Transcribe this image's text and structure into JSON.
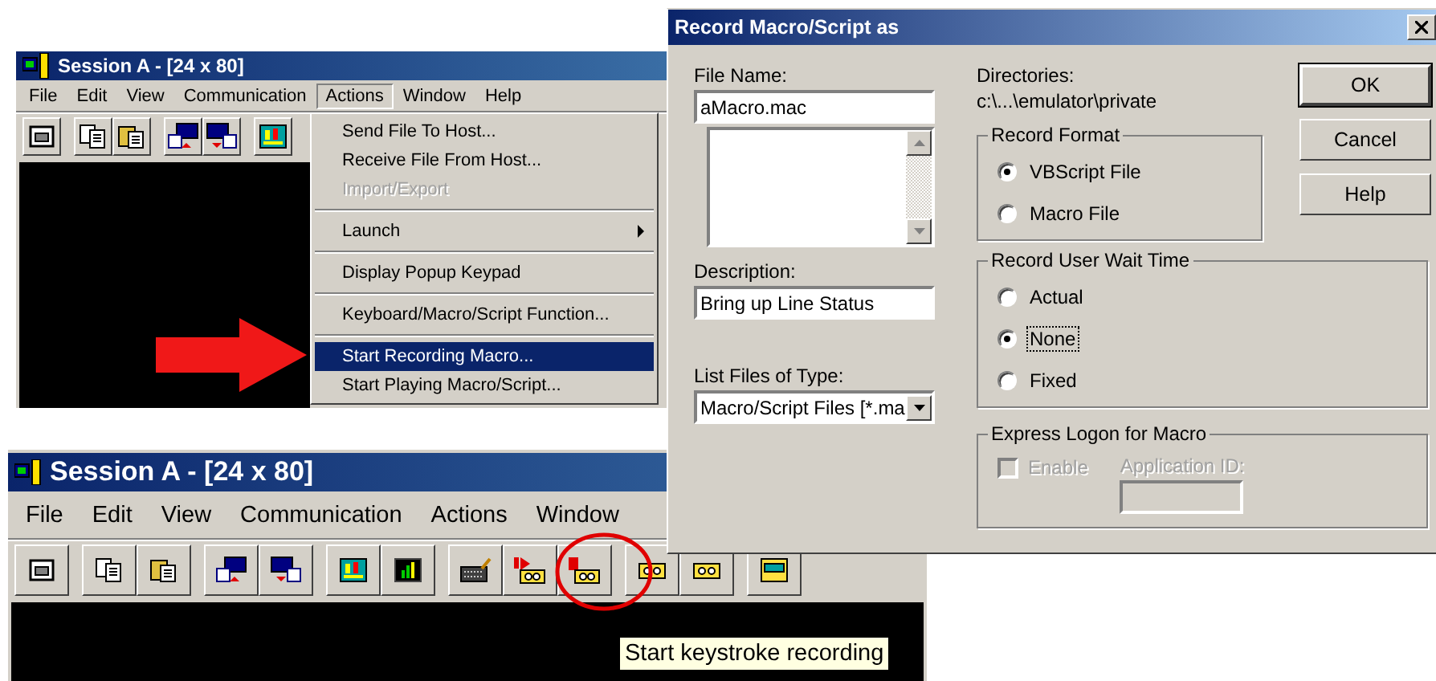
{
  "session_window_top": {
    "title": "Session A - [24 x 80]",
    "menu": [
      {
        "label": "File",
        "selected": false
      },
      {
        "label": "Edit",
        "selected": false
      },
      {
        "label": "View",
        "selected": false
      },
      {
        "label": "Communication",
        "selected": false
      },
      {
        "label": "Actions",
        "selected": true
      },
      {
        "label": "Window",
        "selected": false
      },
      {
        "label": "Help",
        "selected": false
      }
    ],
    "actions_menu": [
      [
        {
          "label": "Send File To Host...",
          "disabled": false,
          "selected": false,
          "submenu": false
        },
        {
          "label": "Receive File From Host...",
          "disabled": false,
          "selected": false,
          "submenu": false
        },
        {
          "label": "Import/Export",
          "disabled": true,
          "selected": false,
          "submenu": false
        }
      ],
      [
        {
          "label": "Launch",
          "disabled": false,
          "selected": false,
          "submenu": true
        }
      ],
      [
        {
          "label": "Display Popup Keypad",
          "disabled": false,
          "selected": false,
          "submenu": false
        }
      ],
      [
        {
          "label": "Keyboard/Macro/Script Function...",
          "disabled": false,
          "selected": false,
          "submenu": false
        }
      ],
      [
        {
          "label": "Start Recording Macro...",
          "disabled": false,
          "selected": true,
          "submenu": false
        },
        {
          "label": "Start Playing Macro/Script...",
          "disabled": false,
          "selected": false,
          "submenu": false
        }
      ]
    ]
  },
  "session_window_bottom": {
    "title": "Session A - [24 x 80]",
    "menu": [
      {
        "label": "File",
        "selected": false
      },
      {
        "label": "Edit",
        "selected": false
      },
      {
        "label": "View",
        "selected": false
      },
      {
        "label": "Communication",
        "selected": false
      },
      {
        "label": "Actions",
        "selected": false
      },
      {
        "label": "Window",
        "selected": false
      }
    ],
    "tooltip": "Start keystroke recording"
  },
  "dialog": {
    "title": "Record Macro/Script as",
    "file_name": {
      "label": "File Name:",
      "value": "aMacro.mac"
    },
    "directories": {
      "label": "Directories:",
      "path": "c:\\...\\emulator\\private"
    },
    "description": {
      "label": "Description:",
      "value": "Bring up Line Status"
    },
    "file_type": {
      "label": "List Files of Type:",
      "value": "Macro/Script Files [*.ma"
    },
    "record_format": {
      "title": "Record Format",
      "options": [
        {
          "label": "VBScript File",
          "selected": true,
          "focused": false
        },
        {
          "label": "Macro File",
          "selected": false,
          "focused": false
        }
      ]
    },
    "wait_time": {
      "title": "Record User Wait Time",
      "options": [
        {
          "label": "Actual",
          "selected": false,
          "focused": false
        },
        {
          "label": "None",
          "selected": true,
          "focused": true
        },
        {
          "label": "Fixed",
          "selected": false,
          "focused": false
        }
      ]
    },
    "express_logon": {
      "title": "Express Logon for Macro",
      "enable": {
        "label": "Enable",
        "checked": false,
        "disabled": true
      },
      "application_id": {
        "label": "Application ID:",
        "disabled": true
      }
    },
    "buttons": [
      {
        "label": "OK",
        "default": true
      },
      {
        "label": "Cancel",
        "default": false
      },
      {
        "label": "Help",
        "default": false
      }
    ]
  }
}
